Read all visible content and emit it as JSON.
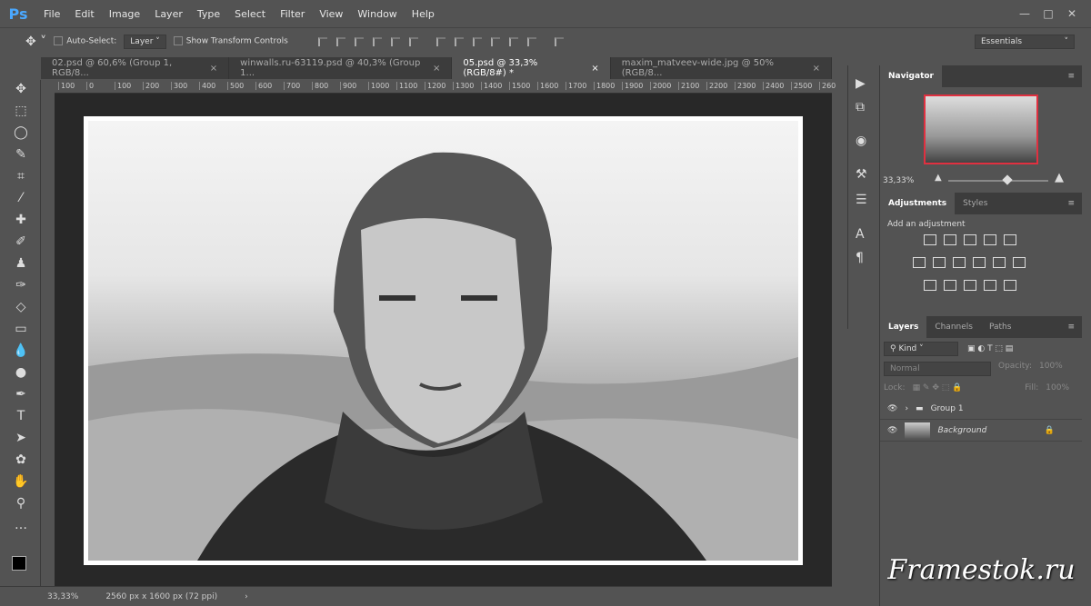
{
  "app": {
    "logo": "Ps"
  },
  "menu": [
    "File",
    "Edit",
    "Image",
    "Layer",
    "Type",
    "Select",
    "Filter",
    "View",
    "Window",
    "Help"
  ],
  "window_controls": [
    "—",
    "□",
    "✕"
  ],
  "options": {
    "auto_select_label": "Auto-Select:",
    "auto_select_value": "Layer",
    "show_transform_label": "Show Transform Controls",
    "workspace": "Essentials"
  },
  "tabs": [
    {
      "label": "02.psd @ 60,6% (Group 1, RGB/8...",
      "active": false
    },
    {
      "label": "winwalls.ru-63119.psd @ 40,3% (Group 1...",
      "active": false
    },
    {
      "label": "05.psd @ 33,3% (RGB/8#) *",
      "active": true
    },
    {
      "label": "maxim_matveev-wide.jpg @ 50% (RGB/8...",
      "active": false
    }
  ],
  "ruler": [
    "100",
    "0",
    "100",
    "200",
    "300",
    "400",
    "500",
    "600",
    "700",
    "800",
    "900",
    "1000",
    "1100",
    "1200",
    "1300",
    "1400",
    "1500",
    "1600",
    "1700",
    "1800",
    "1900",
    "2000",
    "2100",
    "2200",
    "2300",
    "2400",
    "2500",
    "260"
  ],
  "status": {
    "zoom": "33,33%",
    "doc_size": "2560 px x 1600 px (72 ppi)"
  },
  "navigator": {
    "title": "Navigator",
    "zoom": "33,33%",
    "zoom_fraction": 0.55
  },
  "adjustments": {
    "tabs": [
      "Adjustments",
      "Styles"
    ],
    "subtitle": "Add an adjustment"
  },
  "layers": {
    "tabs": [
      "Layers",
      "Channels",
      "Paths"
    ],
    "filter": "Kind",
    "blend": "Normal",
    "opacity_label": "Opacity:",
    "opacity": "100%",
    "lock_label": "Lock:",
    "fill_label": "Fill:",
    "fill": "100%",
    "items": [
      {
        "name": "Group 1",
        "type": "group"
      },
      {
        "name": "Background",
        "type": "image",
        "locked": true
      }
    ]
  },
  "watermark": "Framestok.ru"
}
